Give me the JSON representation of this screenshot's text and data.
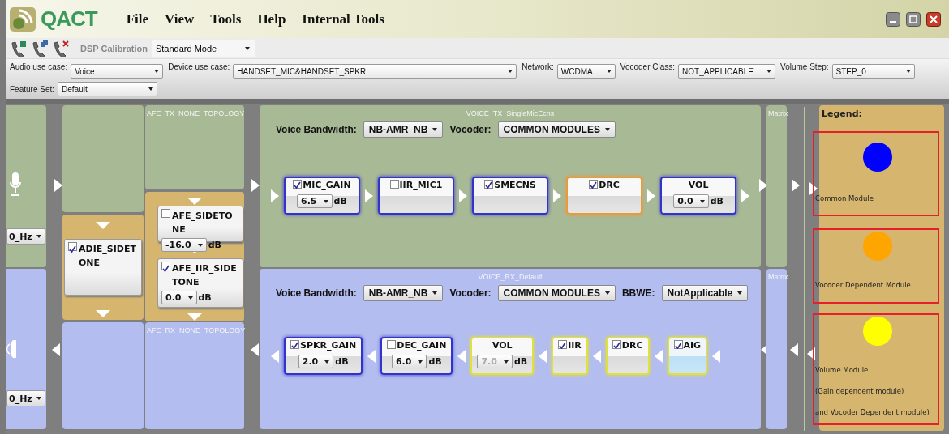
{
  "app": {
    "logo": "QACT",
    "menu": [
      "File",
      "View",
      "Tools",
      "Help",
      "Internal Tools"
    ]
  },
  "toolbar": {
    "label": "DSP Calibration",
    "mode": "Standard Mode"
  },
  "filters": [
    {
      "label": "Audio use case:",
      "value": "Voice"
    },
    {
      "label": "Device use case:",
      "value": "HANDSET_MIC&HANDSET_SPKR"
    },
    {
      "label": "Network:",
      "value": "WCDMA"
    },
    {
      "label": "Vocoder Class:",
      "value": "NOT_APPLICABLE"
    },
    {
      "label": "Volume Step:",
      "value": "STEP_0"
    },
    {
      "label": "Feature Set:",
      "value": "Default"
    }
  ],
  "tx_device": {
    "sample_rate": "0_Hz"
  },
  "rx_device": {
    "sample_rate": "0_Hz"
  },
  "afe": {
    "tx_title": "AFE_TX_NONE_TOPOLOGY",
    "rx_title": "AFE_RX_NONE_TOPOLOGY"
  },
  "adie_sidetone": {
    "name": "ADIE_SIDETONE",
    "checked": true
  },
  "afe_sidetones": [
    {
      "name": "AFE_SIDETONE",
      "checked": false,
      "gain": "-16.0",
      "unit": "dB"
    },
    {
      "name": "AFE_IIR_SIDETONE",
      "checked": true,
      "gain": "0.0",
      "unit": "dB"
    }
  ],
  "voice_tx": {
    "title": "VOICE_TX_SingleMicEcns",
    "controls": [
      {
        "label": "Voice Bandwidth:",
        "value": "NB-AMR_NB"
      },
      {
        "label": "Vocoder:",
        "value": "COMMON MODULES"
      }
    ],
    "modules": [
      {
        "kind": "check",
        "name": "MIC_GAIN",
        "checked": true,
        "color": "#3333cc",
        "selected": false,
        "gain": {
          "value": "6.5",
          "unit": "dB",
          "disabled": false
        }
      },
      {
        "kind": "check",
        "name": "IIR_MIC1",
        "checked": false,
        "color": "#3333cc",
        "selected": false
      },
      {
        "kind": "check",
        "name": "SMECNS",
        "checked": true,
        "color": "#3333cc",
        "selected": false
      },
      {
        "kind": "check",
        "name": "DRC",
        "checked": true,
        "color": "#e89a3c",
        "selected": false
      },
      {
        "kind": "plain",
        "name": "VOL",
        "color": "#3333cc",
        "selected": false,
        "gain": {
          "value": "0.0",
          "unit": "dB",
          "disabled": false
        }
      }
    ]
  },
  "voice_rx": {
    "title": "VOICE_RX_Default",
    "controls": [
      {
        "label": "Voice Bandwidth:",
        "value": "NB-AMR_NB"
      },
      {
        "label": "Vocoder:",
        "value": "COMMON MODULES"
      },
      {
        "label": "BBWE:",
        "value": "NotApplicable"
      }
    ],
    "modules": [
      {
        "kind": "check",
        "name": "SPKR_GAIN",
        "checked": true,
        "color": "#3333cc",
        "selected": false,
        "gain": {
          "value": "2.0",
          "unit": "dB",
          "disabled": false
        }
      },
      {
        "kind": "check",
        "name": "DEC_GAIN",
        "checked": false,
        "color": "#3333cc",
        "selected": false,
        "gain": {
          "value": "6.0",
          "unit": "dB",
          "disabled": false
        }
      },
      {
        "kind": "plain",
        "name": "VOL",
        "color": "#e0e040",
        "selected": false,
        "gain": {
          "value": "7.0",
          "unit": "dB",
          "disabled": true
        }
      },
      {
        "kind": "check",
        "name": "IIR",
        "checked": true,
        "color": "#e0e040",
        "selected": false
      },
      {
        "kind": "check",
        "name": "DRC",
        "checked": true,
        "color": "#e0e040",
        "selected": false
      },
      {
        "kind": "check",
        "name": "AIG",
        "checked": true,
        "color": "#e0e040",
        "selected": true
      }
    ]
  },
  "matrix": [
    "Matrix",
    "Matrix"
  ],
  "legend": {
    "title": "Legend:",
    "items": [
      {
        "color": "#0000ff",
        "lines": [
          "Common Module"
        ]
      },
      {
        "color": "#ffa500",
        "lines": [
          "Vocoder Dependent Module"
        ]
      },
      {
        "color": "#ffff00",
        "lines": [
          "Volume Module",
          "(Gain dependent module)",
          "and Vocoder Dependent  module)"
        ]
      }
    ]
  }
}
